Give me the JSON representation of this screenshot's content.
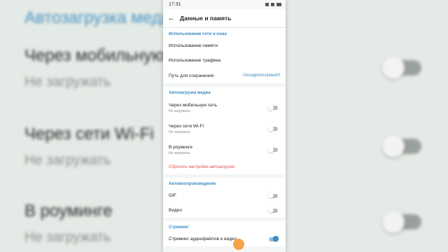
{
  "background": {
    "title": "Автозагрузка медиа",
    "rows": [
      {
        "label": "Через мобильную",
        "sub": "Не загружать"
      },
      {
        "label": "Через сети Wi-Fi",
        "sub": "Не загружать"
      },
      {
        "label": "В роуминге",
        "sub": "Не загружать"
      }
    ]
  },
  "status": {
    "time": "17:31"
  },
  "appbar": {
    "title": "Данные и память",
    "back_icon": "arrow-left"
  },
  "network_section": {
    "header": "Использование сети и кэша",
    "items": [
      {
        "label": "Использование памяти"
      },
      {
        "label": "Использование трафика"
      },
      {
        "label": "Путь для сохранения",
        "value": "/storage/emulated/0"
      }
    ]
  },
  "autodownload_section": {
    "header": "Автозагрузка медиа",
    "items": [
      {
        "label": "Через мобильную сеть",
        "sub": "Не загружать",
        "enabled": false
      },
      {
        "label": "Через сети Wi-Fi",
        "sub": "Не загружать",
        "enabled": false
      },
      {
        "label": "В роуминге",
        "sub": "Не загружать",
        "enabled": false
      }
    ],
    "reset_label": "Сбросить настройки автозагрузки"
  },
  "autoplay_section": {
    "header": "Автовоспроизведение",
    "items": [
      {
        "label": "GIF",
        "enabled": false
      },
      {
        "label": "Видео",
        "enabled": false
      }
    ]
  },
  "streaming_section": {
    "header": "Стриминг",
    "items": [
      {
        "label": "Стриминг аудиофайлов и видео",
        "enabled": true
      }
    ]
  },
  "colors": {
    "accent": "#3a8dc5",
    "danger": "#d9534f",
    "fab": "#f39c33"
  }
}
